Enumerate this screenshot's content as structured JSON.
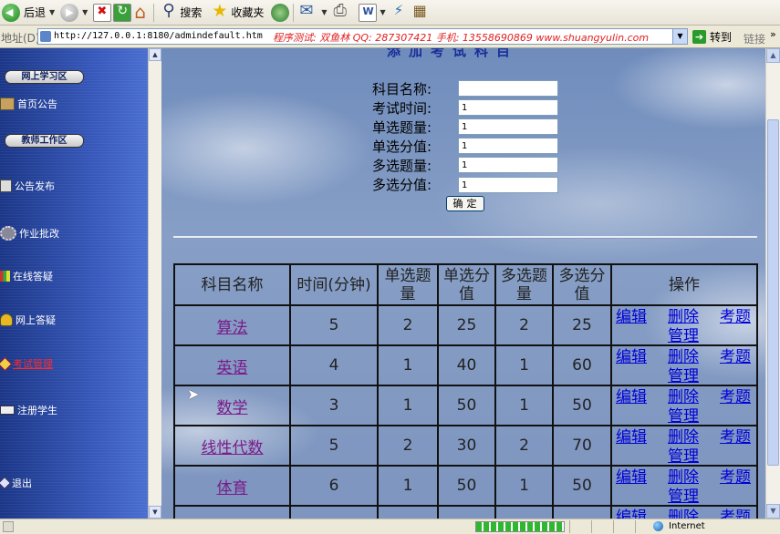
{
  "toolbar": {
    "back_label": "后退",
    "search_label": "搜索",
    "favorites_label": "收藏夹"
  },
  "addressbar": {
    "label": "地址(D)",
    "url": "http://127.0.0.1:8180/admindefault.htm",
    "promo": "程序测试: 双鱼林  QQ: 287307421  手机: 13558690869  www.shuangyulin.com",
    "go_label": "转到",
    "links_label": "链接",
    "chevron": "»"
  },
  "sidebar": {
    "section1": "网上学习区",
    "section2": "教师工作区",
    "items": [
      {
        "label": "首页公告",
        "icon": "book-icon"
      },
      {
        "label": "公告发布",
        "icon": "announcement-icon"
      },
      {
        "label": "作业批改",
        "icon": "gear-icon"
      },
      {
        "label": "在线答疑",
        "icon": "books-icon"
      },
      {
        "label": "网上答疑",
        "icon": "person-icon"
      },
      {
        "label": "考试管理",
        "icon": "diamond-icon",
        "active": true
      },
      {
        "label": "注册学生",
        "icon": "card-icon"
      },
      {
        "label": "退出",
        "icon": "exit-icon"
      }
    ]
  },
  "form": {
    "title": "添加考试科目",
    "fields": [
      {
        "label": "科目名称:",
        "value": ""
      },
      {
        "label": "考试时间:",
        "value": "1"
      },
      {
        "label": "单选题量:",
        "value": "1"
      },
      {
        "label": "单选分值:",
        "value": "1"
      },
      {
        "label": "多选题量:",
        "value": "1"
      },
      {
        "label": "多选分值:",
        "value": "1"
      }
    ],
    "submit_label": "确定"
  },
  "table": {
    "headers": [
      "科目名称",
      "时间(分钟)",
      "单选题量",
      "单选分值",
      "多选题量",
      "多选分值",
      "操作"
    ],
    "ops": {
      "edit": "编辑",
      "delete": "删除",
      "manage": "管理",
      "questions": "考题"
    },
    "rows": [
      {
        "name": "算法",
        "time": "5",
        "single_count": "2",
        "single_score": "25",
        "multi_count": "2",
        "multi_score": "25"
      },
      {
        "name": "英语",
        "time": "4",
        "single_count": "1",
        "single_score": "40",
        "multi_count": "1",
        "multi_score": "60"
      },
      {
        "name": "数学",
        "time": "3",
        "single_count": "1",
        "single_score": "50",
        "multi_count": "1",
        "multi_score": "50"
      },
      {
        "name": "线性代数",
        "time": "5",
        "single_count": "2",
        "single_score": "30",
        "multi_count": "2",
        "multi_score": "70"
      },
      {
        "name": "体育",
        "time": "6",
        "single_count": "1",
        "single_score": "50",
        "multi_count": "1",
        "multi_score": "50"
      }
    ]
  },
  "status": {
    "progress": 1.0,
    "zone": "Internet"
  },
  "colors": {
    "sidebar_blue": "#2a4aa8",
    "active_menu": "#ff2a2a",
    "link_blue": "#0000d8",
    "visited_purple": "#7a1a8a"
  }
}
